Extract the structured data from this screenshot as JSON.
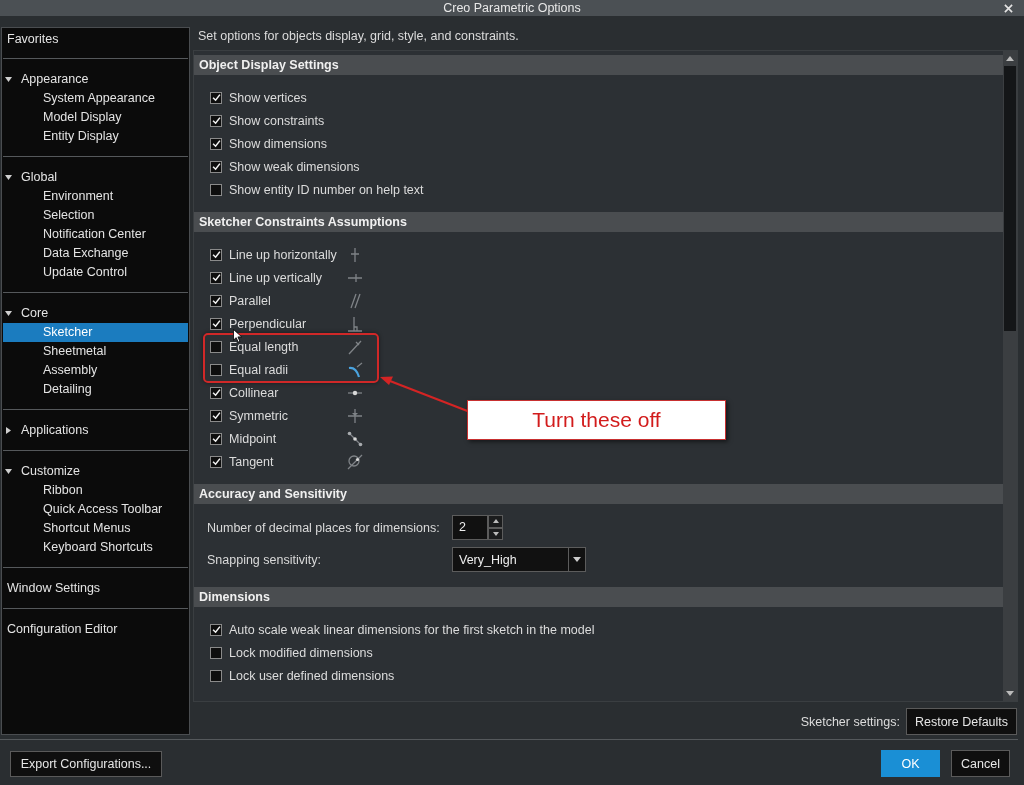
{
  "window": {
    "title": "Creo Parametric Options"
  },
  "sidebar": {
    "groups": [
      {
        "kind": "entry",
        "label": "Favorites",
        "selected": false
      },
      {
        "kind": "category",
        "label": "Appearance",
        "expanded": true,
        "children": [
          {
            "label": "System Appearance",
            "selected": false
          },
          {
            "label": "Model Display",
            "selected": false
          },
          {
            "label": "Entity Display",
            "selected": false
          }
        ]
      },
      {
        "kind": "category",
        "label": "Global",
        "expanded": true,
        "children": [
          {
            "label": "Environment",
            "selected": false
          },
          {
            "label": "Selection",
            "selected": false
          },
          {
            "label": "Notification Center",
            "selected": false
          },
          {
            "label": "Data Exchange",
            "selected": false
          },
          {
            "label": "Update Control",
            "selected": false
          }
        ]
      },
      {
        "kind": "category",
        "label": "Core",
        "expanded": true,
        "children": [
          {
            "label": "Sketcher",
            "selected": true
          },
          {
            "label": "Sheetmetal",
            "selected": false
          },
          {
            "label": "Assembly",
            "selected": false
          },
          {
            "label": "Detailing",
            "selected": false
          }
        ]
      },
      {
        "kind": "category",
        "label": "Applications",
        "expanded": false
      },
      {
        "kind": "category",
        "label": "Customize",
        "expanded": true,
        "children": [
          {
            "label": "Ribbon",
            "selected": false
          },
          {
            "label": "Quick Access Toolbar",
            "selected": false
          },
          {
            "label": "Shortcut Menus",
            "selected": false
          },
          {
            "label": "Keyboard Shortcuts",
            "selected": false
          }
        ]
      },
      {
        "kind": "entry",
        "label": "Window Settings",
        "selected": false
      },
      {
        "kind": "entry",
        "label": "Configuration Editor",
        "selected": false
      }
    ]
  },
  "description": "Set options for objects display, grid, style, and constraints.",
  "sections": [
    {
      "title": "Object Display Settings",
      "kind": "checklist",
      "items": [
        {
          "label": "Show vertices",
          "checked": true
        },
        {
          "label": "Show constraints",
          "checked": true
        },
        {
          "label": "Show dimensions",
          "checked": true
        },
        {
          "label": "Show weak dimensions",
          "checked": true
        },
        {
          "label": "Show entity ID number on help text",
          "checked": false
        }
      ]
    },
    {
      "title": "Sketcher Constraints Assumptions",
      "kind": "constraints",
      "items": [
        {
          "label": "Line up horizontally",
          "checked": true,
          "highlighted": false
        },
        {
          "label": "Line up vertically",
          "checked": true,
          "highlighted": false
        },
        {
          "label": "Parallel",
          "checked": true,
          "highlighted": false
        },
        {
          "label": "Perpendicular",
          "checked": true,
          "highlighted": false
        },
        {
          "label": "Equal length",
          "checked": false,
          "highlighted": true
        },
        {
          "label": "Equal radii",
          "checked": false,
          "highlighted": true
        },
        {
          "label": "Collinear",
          "checked": true,
          "highlighted": false
        },
        {
          "label": "Symmetric",
          "checked": true,
          "highlighted": false
        },
        {
          "label": "Midpoint",
          "checked": true,
          "highlighted": false
        },
        {
          "label": "Tangent",
          "checked": true,
          "highlighted": false
        }
      ]
    },
    {
      "title": "Accuracy and Sensitivity",
      "kind": "form",
      "fields": [
        {
          "kind": "spinner",
          "label": "Number of decimal places for dimensions:",
          "value": "2"
        },
        {
          "kind": "dropdown",
          "label": "Snapping sensitivity:",
          "value": "Very_High"
        }
      ]
    },
    {
      "title": "Dimensions",
      "kind": "checklist",
      "items": [
        {
          "label": "Auto scale weak linear dimensions for the first sketch in the model",
          "checked": true
        },
        {
          "label": "Lock modified dimensions",
          "checked": false
        },
        {
          "label": "Lock user defined dimensions",
          "checked": false
        }
      ]
    }
  ],
  "footer": {
    "label": "Sketcher settings:",
    "restore_button": "Restore Defaults"
  },
  "export_button": "Export Configurations...",
  "dialog_buttons": [
    {
      "label": "OK",
      "kind": "primary"
    },
    {
      "label": "Cancel",
      "kind": "secondary"
    }
  ],
  "annotation": {
    "callout": "Turn these off"
  }
}
